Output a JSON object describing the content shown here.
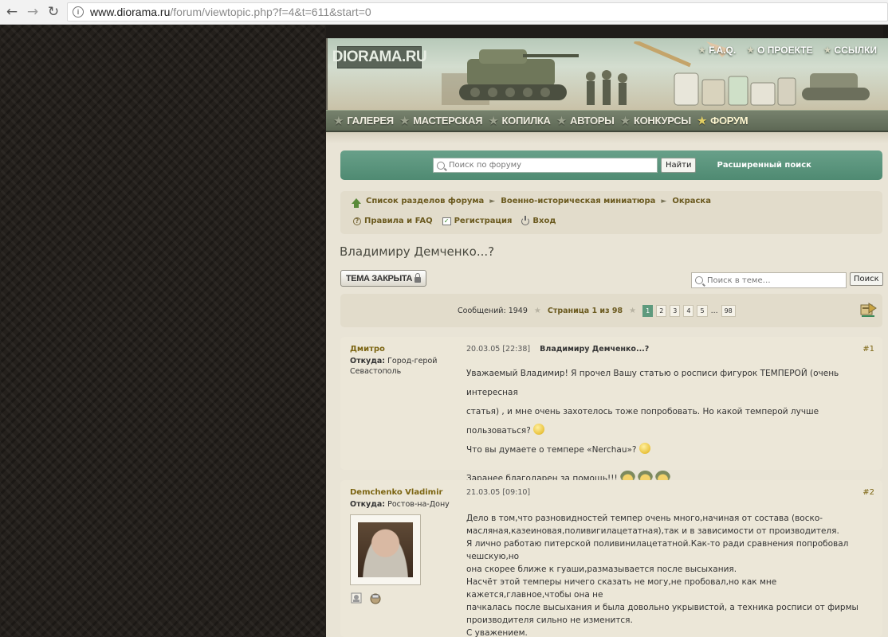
{
  "browser": {
    "url_host": "www.diorama.ru",
    "url_path": "/forum/viewtopic.php?f=4&t=611&start=0"
  },
  "header": {
    "logo": "DIORAMA.RU",
    "top_links": [
      "F.A.Q.",
      "О ПРОЕКТЕ",
      "ССЫЛКИ"
    ],
    "menu": [
      "ГАЛЕРЕЯ",
      "МАСТЕРСКАЯ",
      "КОПИЛКА",
      "АВТОРЫ",
      "КОНКУРСЫ",
      "ФОРУМ"
    ],
    "current_menu": "ФОРУМ"
  },
  "search": {
    "placeholder": "Поиск по форуму",
    "button": "Найти",
    "advanced": "Расширенный поиск"
  },
  "breadcrumb": {
    "items": [
      "Список разделов форума",
      "Военно-историческая миниатюра",
      "Окраска"
    ]
  },
  "userlinks": {
    "rules": "Правила и FAQ",
    "register": "Регистрация",
    "login": "Вход"
  },
  "topic": {
    "title": "Владимиру Демченко...?",
    "locked_label": "ТЕМА ЗАКРЫТА",
    "search_placeholder": "Поиск в теме…",
    "search_button": "Поиск"
  },
  "pagination": {
    "messages": "Сообщений: 1949",
    "page_info": "Страница 1 из 98",
    "pages": [
      "1",
      "2",
      "3",
      "4",
      "5"
    ],
    "ellipsis": "…",
    "last": "98",
    "current": "1"
  },
  "posts": [
    {
      "author": "Дмитро",
      "from_label": "Откуда:",
      "from": "Город-герой Севастополь",
      "date": "20.03.05 [22:38]",
      "title": "Владимиру Демченко...?",
      "number": "#1",
      "lines": [
        "Уважаемый Владимир! Я прочел Вашу статью о росписи фигурок ТЕМПЕРОЙ (очень интересная",
        "статья) , и мне очень захотелось тоже попробовать. Но какой темперой лучше пользоваться?",
        "Что вы думаете о темпере «Nerchau»?",
        "",
        "Заранее благодарен за помощь!!!"
      ]
    },
    {
      "author": "Demchenko Vladimir",
      "from_label": "Откуда:",
      "from": "Ростов-на-Дону",
      "date": "21.03.05 [09:10]",
      "title": "",
      "number": "#2",
      "lines": [
        "Дело в том,что разновидностей темпер очень много,начиная от состава (воско-",
        "масляная,казеиновая,поливигилацетатная),так и в зависимости от производителя.",
        "Я лично работаю питерской поливинилацетатной.Как-то ради сравнения попробовал чешскую,но",
        "она скорее ближе к гуаши,размазывается после высыхания.",
        "Насчёт этой темперы ничего сказать не могу,не пробовал,но как мне кажется,главное,чтобы она не",
        "пачкалась после высыхания и была довольно укрывистой, а техника росписи от фирмы",
        "производителя сильно не изменится.",
        "С уважением."
      ]
    }
  ]
}
